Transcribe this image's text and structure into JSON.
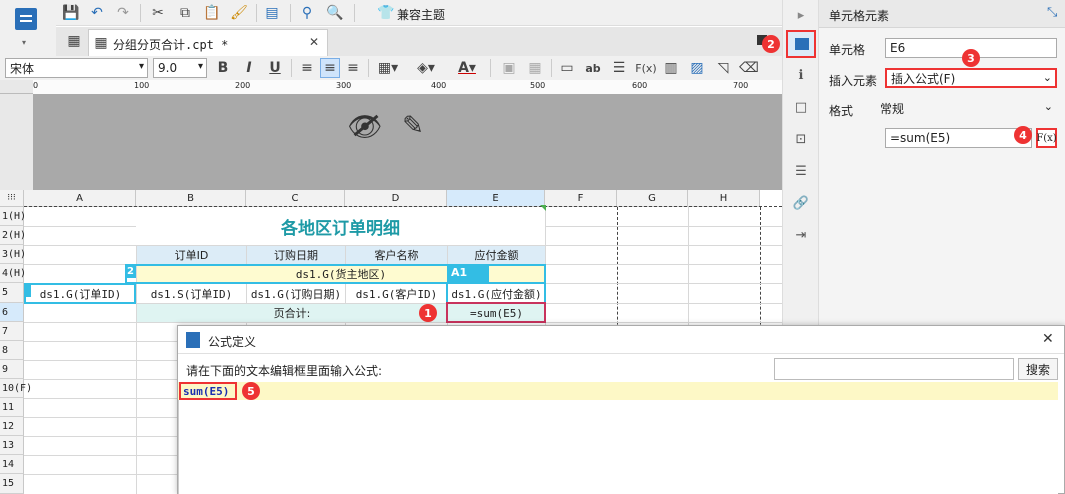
{
  "toolbar": {
    "theme_label": "兼容主题"
  },
  "tab": {
    "title": "分组分页合计.cpt *",
    "close": "✕"
  },
  "format": {
    "font": "宋体",
    "size": "9.0"
  },
  "ruler": {
    "ticks": [
      "0",
      "100",
      "200",
      "300",
      "400",
      "500",
      "600",
      "700"
    ]
  },
  "columns": [
    "A",
    "B",
    "C",
    "D",
    "E",
    "F",
    "G",
    "H"
  ],
  "rows": [
    "1(H)",
    "2(H)",
    "3(H)",
    "4(H)",
    "5",
    "6",
    "7",
    "8",
    "9",
    "10(F)",
    "11",
    "12",
    "13",
    "14",
    "15"
  ],
  "cells": {
    "title": "各地区订单明细",
    "h_order_id": "订单ID",
    "h_order_date": "订购日期",
    "h_customer": "客户名称",
    "h_amount": "应付金额",
    "r4": "ds1.G(货主地区)",
    "a5": "ds1.G(订单ID)",
    "b5": "ds1.S(订单ID)",
    "c5": "ds1.G(订购日期)",
    "d5": "ds1.G(客户ID)",
    "e5": "ds1.G(应付金额)",
    "b6": "页合计:",
    "e6": "=sum(E5)",
    "flag_a1": "A1",
    "flag_2": "2",
    "flag_1": "1"
  },
  "panel": {
    "header": "单元格元素",
    "cell_label": "单元格",
    "cell_value": "E6",
    "insert_label": "插入元素",
    "insert_value": "插入公式(F)",
    "format_label": "格式",
    "format_value": "常规",
    "formula_value": "=sum(E5)",
    "fx": "F(x)"
  },
  "dialog": {
    "title": "公式定义",
    "prompt": "请在下面的文本编辑框里面输入公式:",
    "search_btn": "搜索",
    "formula": "sum(E5)"
  },
  "badges": [
    "1",
    "2",
    "3",
    "4",
    "5"
  ]
}
